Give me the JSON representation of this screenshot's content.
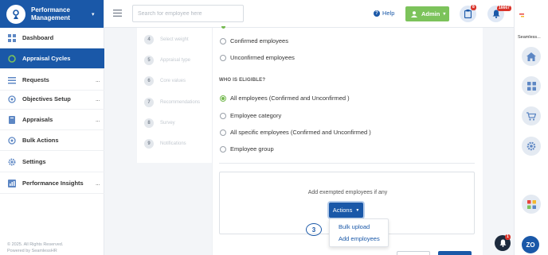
{
  "app": {
    "title": "Performance Management"
  },
  "sidebar": {
    "items": [
      {
        "label": "Dashboard",
        "icon": "dashboard-icon"
      },
      {
        "label": "Appraisal Cycles",
        "icon": "cycle-icon"
      },
      {
        "label": "Requests",
        "icon": "list-icon"
      },
      {
        "label": "Objectives Setup",
        "icon": "target-icon"
      },
      {
        "label": "Appraisals",
        "icon": "book-icon"
      },
      {
        "label": "Bulk Actions",
        "icon": "target-icon"
      },
      {
        "label": "Settings",
        "icon": "gear-icon"
      },
      {
        "label": "Performance Insights",
        "icon": "insights-icon"
      }
    ],
    "more_label": "...",
    "copyright": "© 2025. All Rights Reserved.",
    "powered_by": "Powered by SeamlessHR"
  },
  "topbar": {
    "search_placeholder": "Search for employee here",
    "help_label": "Help",
    "admin_label": "Admin",
    "clipboard_badge": "8",
    "bell_badge": "16667"
  },
  "steps": [
    {
      "num": "4",
      "label": "Select weight"
    },
    {
      "num": "5",
      "label": "Appraisal type"
    },
    {
      "num": "6",
      "label": "Core values"
    },
    {
      "num": "7",
      "label": "Recommendations"
    },
    {
      "num": "8",
      "label": "Survey"
    },
    {
      "num": "9",
      "label": "Notifications"
    }
  ],
  "main": {
    "employee_status_options": [
      {
        "label": "Confirmed employees",
        "checked": false
      },
      {
        "label": "Unconfirmed employees",
        "checked": false
      }
    ],
    "eligible_title": "WHO IS ELIGIBLE?",
    "eligible_options": [
      {
        "label": "All employees (Confirmed and Unconfirmed )",
        "checked": true
      },
      {
        "label": "Employee category",
        "checked": false
      },
      {
        "label": "All specific employees (Confirmed and Unconfirmed )",
        "checked": false
      },
      {
        "label": "Employee group",
        "checked": false
      }
    ],
    "exempt_text": "Add exempted employees if any",
    "actions_label": "Actions",
    "dropdown": [
      "Bulk upload",
      "Add employees"
    ],
    "step_marker": "3"
  },
  "rail": {
    "brand": "Seamless...",
    "avatar_initials": "ZO",
    "float_badge": "1"
  },
  "colors": {
    "primary": "#1a58a8",
    "success": "#7cc35b",
    "danger": "#d9342b"
  }
}
